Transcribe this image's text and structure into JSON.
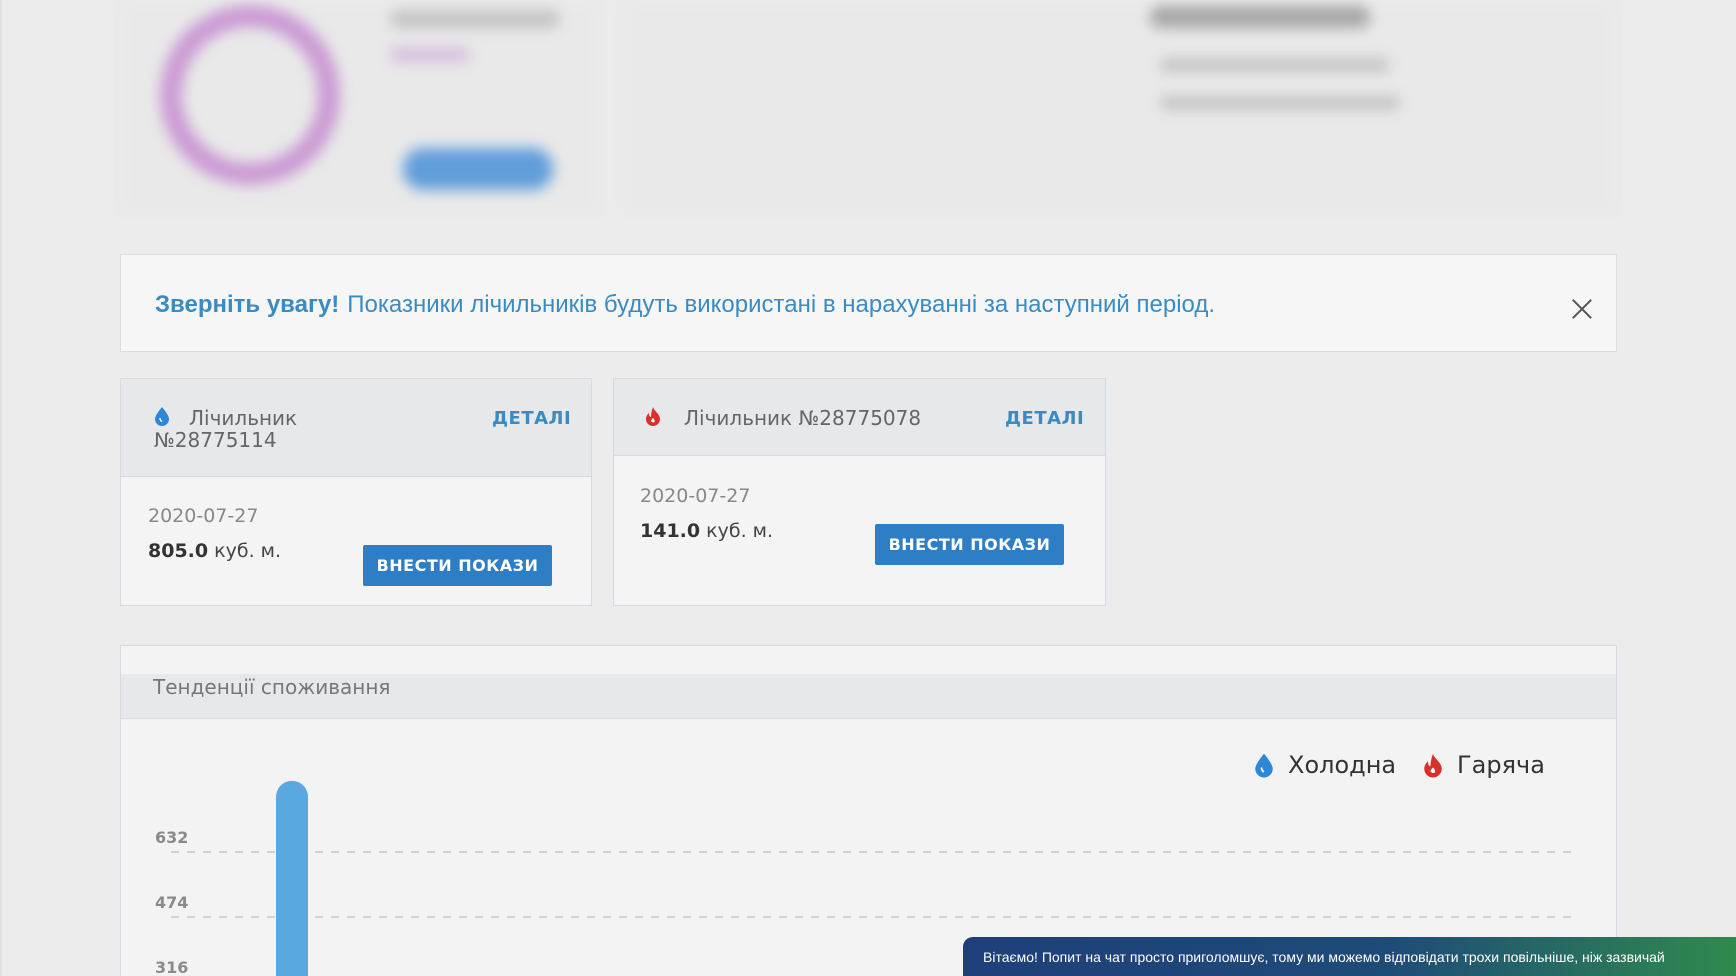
{
  "alert": {
    "title": "Зверніть увагу!",
    "message": "Показники лічильників будуть використані в нарахуванні за наступний період."
  },
  "meters": [
    {
      "type": "cold",
      "name": "Лічильник №28775114",
      "details": "ДЕТАЛІ",
      "date": "2020-07-27",
      "value": "805.0",
      "unit": "куб. м.",
      "button": "ВНЕСТИ ПОКАЗИ",
      "color": "#2f86d6"
    },
    {
      "type": "hot",
      "name": "Лічильник №28775078",
      "details": "ДЕТАЛІ",
      "date": "2020-07-27",
      "value": "141.0",
      "unit": "куб. м.",
      "button": "ВНЕСТИ ПОКАЗИ",
      "color": "#d9302c"
    }
  ],
  "trends": {
    "title": "Тенденції споживання",
    "legend": [
      {
        "label": "Холодна",
        "color": "#2f86d6",
        "icon": "drop-icon"
      },
      {
        "label": "Гаряча",
        "color": "#d9302c",
        "icon": "flame-icon"
      }
    ]
  },
  "chart_data": {
    "type": "bar",
    "yticks": [
      316,
      474,
      632
    ],
    "series": [
      {
        "name": "Холодна",
        "color": "#5aa8e0",
        "values": [
          805
        ]
      }
    ]
  },
  "chat": {
    "message": "Вітаємо! Попит на чат просто приголомшує, тому ми можемо відповідати трохи повільніше, ніж зазвичай"
  }
}
